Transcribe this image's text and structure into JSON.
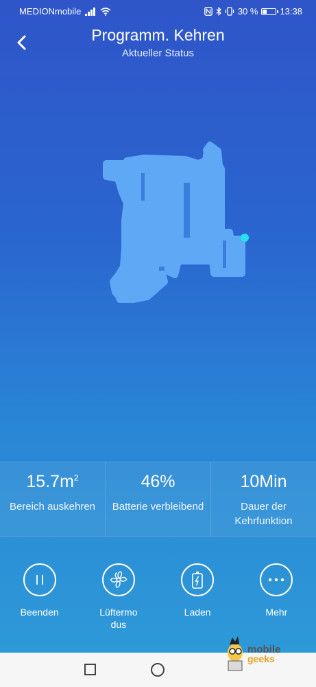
{
  "status_bar": {
    "carrier": "MEDIONmobile",
    "battery_percent": "30 %",
    "battery_level": 0.3,
    "time": "13:38",
    "icons": [
      "signal-icon",
      "wifi-icon",
      "nfc-icon",
      "bluetooth-icon",
      "vibrate-icon",
      "battery-icon"
    ]
  },
  "header": {
    "title": "Programm. Kehren",
    "subtitle": "Aktueller Status",
    "back_icon": "chevron-left-icon"
  },
  "map": {
    "cleaned_color": "#5ea8f5",
    "robot_color": "#22e0f0"
  },
  "stats": [
    {
      "value": "15.7m",
      "unit_superscript": "2",
      "label": "Bereich auskehren"
    },
    {
      "value": "46%",
      "label": "Batterie verbleibend"
    },
    {
      "value": "10Min",
      "label": "Dauer der Kehrfunktion"
    }
  ],
  "actions": [
    {
      "icon": "pause-icon",
      "label": "Beenden"
    },
    {
      "icon": "fan-icon",
      "label": "Lüftermo dus"
    },
    {
      "icon": "battery-charge-icon",
      "label": "Laden"
    },
    {
      "icon": "more-icon",
      "label": "Mehr"
    }
  ],
  "watermark": {
    "line1": "mobile",
    "line2": "geeks"
  },
  "colors": {
    "gradient_top": "#2f55c9",
    "gradient_bottom": "#2e9cd8",
    "navbar": "#f6f6f6"
  }
}
